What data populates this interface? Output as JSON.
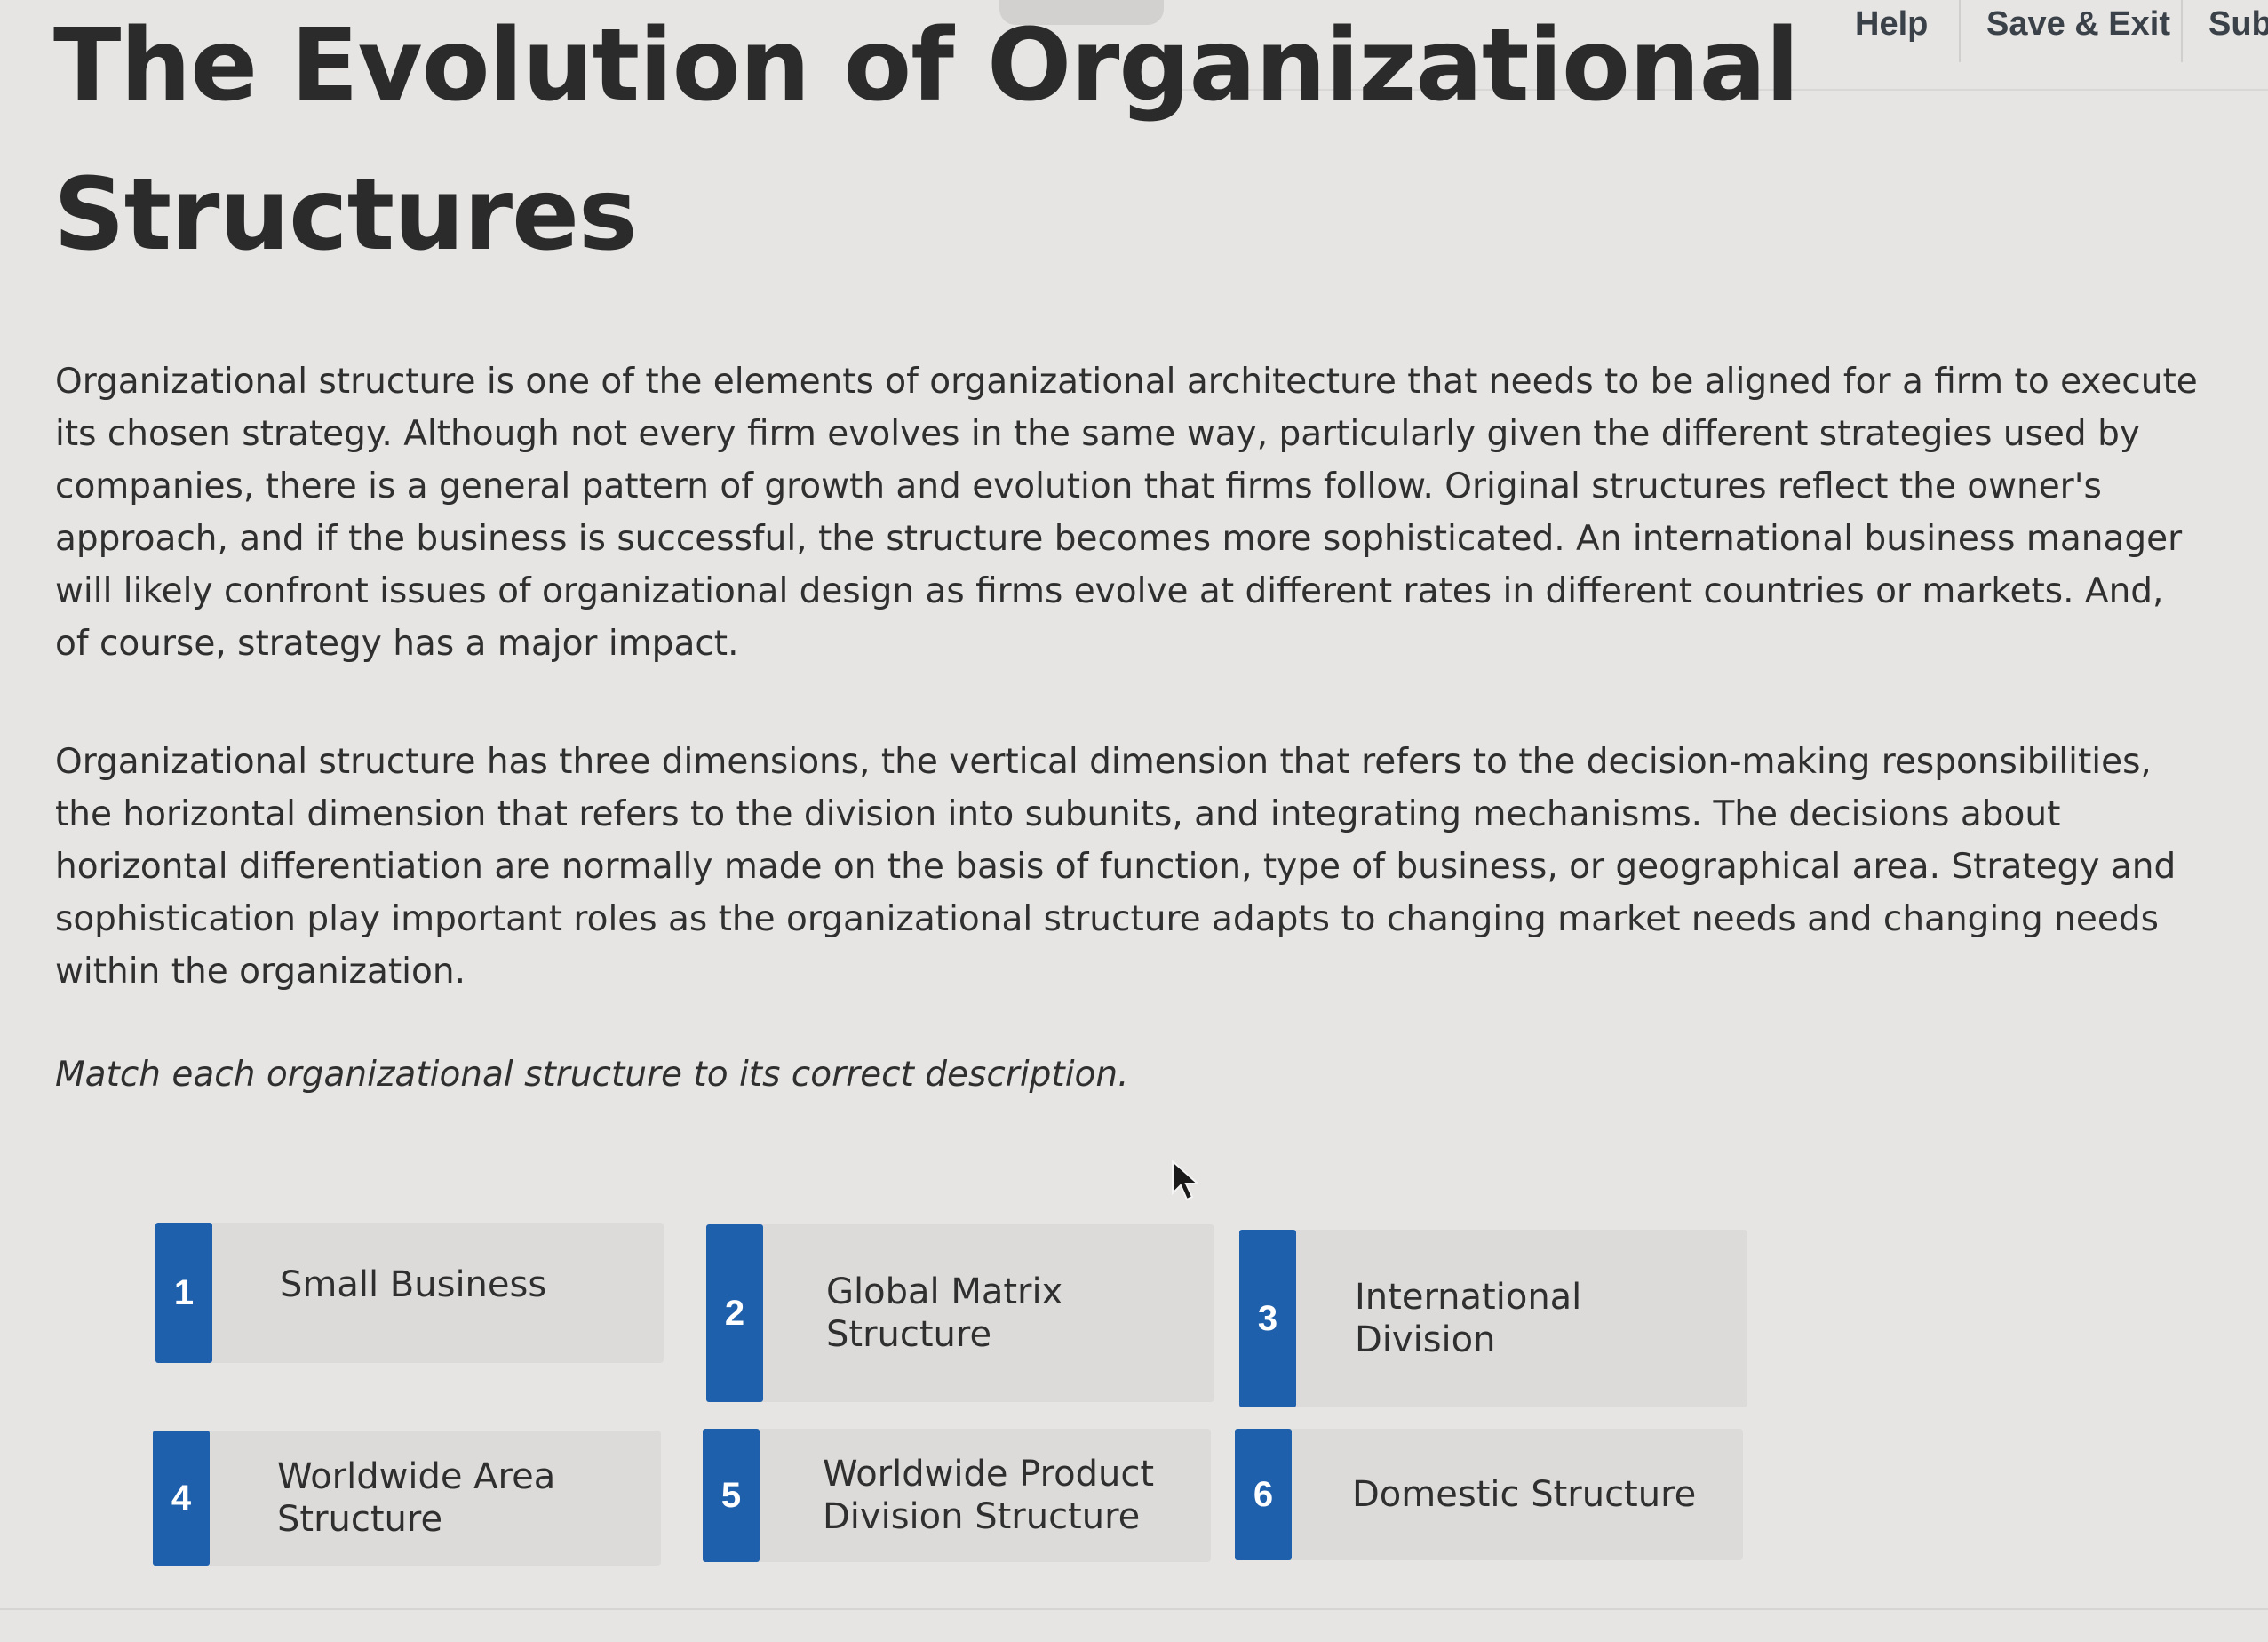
{
  "header": {
    "help_label": "Help",
    "save_exit_label": "Save & Exit",
    "submit_label": "Sub"
  },
  "title": "The Evolution of Organizational Structures",
  "paragraphs": [
    "Organizational structure is one of the elements of organizational architecture that needs to be aligned for a firm to execute its chosen strategy. Although not every firm evolves in the same way, particularly given the different strategies used by companies, there is a general pattern of growth and evolution that firms follow. Original structures reflect the owner's approach, and if the business is successful, the structure becomes more sophisticated. An international business manager will likely confront issues of organizational design as firms evolve at different rates in different countries or markets. And, of course, strategy has a major impact.",
    "Organizational structure has three dimensions, the vertical dimension that refers to the decision-making responsibilities, the horizontal dimension that refers to the division into subunits, and integrating mechanisms. The decisions about horizontal differentiation are normally made on the basis of function, type of business, or geographical area. Strategy and sophistication play important roles as the organizational structure adapts to changing market needs and changing needs within the organization."
  ],
  "instruction": "Match each organizational structure to its correct description.",
  "items": [
    {
      "number": "1",
      "label": "Small Business"
    },
    {
      "number": "2",
      "label": "Global Matrix Structure"
    },
    {
      "number": "3",
      "label": "International Division"
    },
    {
      "number": "4",
      "label": "Worldwide Area Structure"
    },
    {
      "number": "5",
      "label": "Worldwide Product Division Structure"
    },
    {
      "number": "6",
      "label": "Domestic Structure"
    }
  ],
  "colors": {
    "accent": "#1f60ad",
    "card_background": "#dcdbd9",
    "page_background": "#e6e5e3"
  }
}
